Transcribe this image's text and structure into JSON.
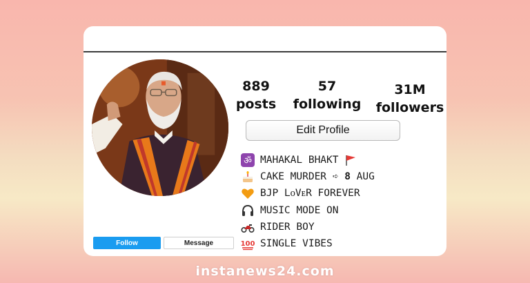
{
  "stats": {
    "posts_count": "889",
    "posts_label": "posts",
    "following_count": "57",
    "following_label": "following",
    "followers_count": "31M",
    "followers_label": "followers"
  },
  "edit_profile_label": "Edit Profile",
  "bio": [
    {
      "icon": "om-icon",
      "text": "MAHAKAL BHAKT",
      "extra_icon": "red-flag-icon"
    },
    {
      "icon": "birthday-cake-icon",
      "pre": "CAKE MURDER ➪ ",
      "bold": "8",
      "post": " AUG"
    },
    {
      "icon": "orange-heart-icon",
      "text": "BJP LOVER FOREVER",
      "display": "BJP LᴏVᴇR FOREVER"
    },
    {
      "icon": "headphones-icon",
      "text": "MUSIC MODE ON"
    },
    {
      "icon": "motorcycle-icon",
      "text": "RIDER BOY"
    },
    {
      "icon": "hundred-points-icon",
      "text": "SINGLE VIBES"
    }
  ],
  "buttons": {
    "follow": "Follow",
    "message": "Message"
  },
  "watermark": "instanews24.com",
  "colors": {
    "follow_button": "#1a9cf0",
    "background_top": "#f9b6ad",
    "background_bottom": "#f6b8b1"
  }
}
